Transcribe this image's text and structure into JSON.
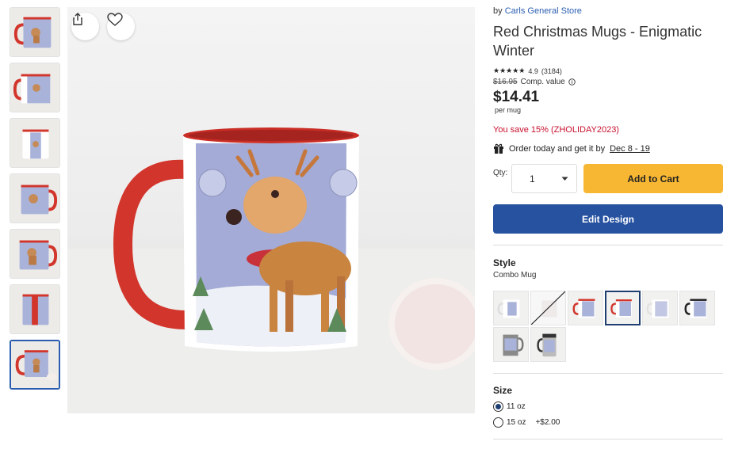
{
  "seller": {
    "prefix": "by",
    "name": "Carls General Store"
  },
  "product": {
    "title": "Red Christmas Mugs - Enigmatic Winter",
    "stars": "★★★★★",
    "rating": "4.9",
    "reviews": "(3184)",
    "comp_price": "$16.95",
    "comp_label": "Comp. value",
    "price": "$14.41",
    "per_unit": "per mug",
    "savings": "You save 15% (ZHOLIDAY2023)",
    "delivery_prefix": "Order today and get it by",
    "delivery_dates": "Dec 8 - 19"
  },
  "purchase": {
    "qty_label": "Qty:",
    "qty_value": "1",
    "add_to_cart": "Add to Cart",
    "edit_design": "Edit Design"
  },
  "style": {
    "heading": "Style",
    "selected": "Combo Mug",
    "options": [
      "Classic Mug",
      "Unavailable",
      "Combo Mug (red)",
      "Combo Mug",
      "Accent Mug (white)",
      "Black Handle Mug",
      "Stein",
      "Travel Mug"
    ]
  },
  "size": {
    "heading": "Size",
    "options": [
      {
        "label": "11 oz",
        "extra": "",
        "selected": true
      },
      {
        "label": "15 oz",
        "extra": "+$2.00",
        "selected": false
      }
    ]
  },
  "icons": {
    "share": "share-icon",
    "favorite": "heart-icon",
    "gift": "gift-icon",
    "info": "info-icon",
    "chevron": "chevron-down-icon"
  },
  "colors": {
    "accent_yellow": "#f7b733",
    "accent_blue": "#2752a0",
    "sale_red": "#c8102e",
    "mug_red": "#d2352b"
  }
}
